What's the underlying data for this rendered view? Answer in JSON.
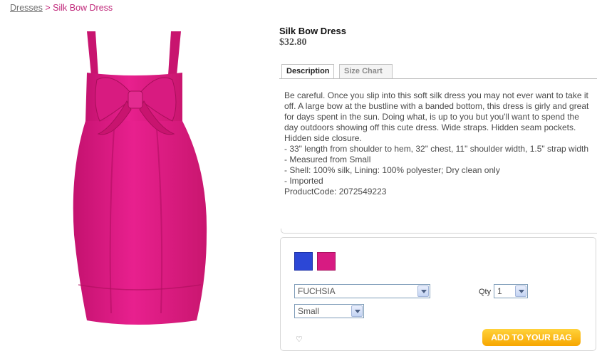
{
  "breadcrumb": {
    "parent": "Dresses",
    "separator": ">",
    "current": "Silk Bow Dress"
  },
  "product": {
    "title": "Silk Bow Dress",
    "price": "$32.80",
    "image_color": "#e0218a"
  },
  "tabs": [
    {
      "label": "Description",
      "active": true
    },
    {
      "label": "Size Chart",
      "active": false
    }
  ],
  "description": {
    "paragraph": "Be careful. Once you slip into this soft silk dress you may not ever want to take it off. A large bow at the bustline with a banded bottom, this dress is girly and great for days spent in the sun. Doing what, is up to you but you'll want to spend the day outdoors showing off this cute dress. Wide straps. Hidden seam pockets. Hidden side closure.",
    "details": [
      "- 33\" length from shoulder to hem, 32\" chest, 11\" shoulder width, 1.5\" strap width",
      "- Measured from Small",
      "- Shell: 100% silk, Lining: 100% polyester; Dry clean only",
      "- Imported",
      "ProductCode: 2072549223"
    ]
  },
  "swatches": [
    {
      "name": "blue",
      "color": "#2c47d6"
    },
    {
      "name": "fuchsia",
      "color": "#d71b82"
    }
  ],
  "options": {
    "color_value": "FUCHSIA",
    "size_value": "Small",
    "qty_label": "Qty",
    "qty_value": "1"
  },
  "add_to_bag_label": "ADD TO YOUR BAG"
}
